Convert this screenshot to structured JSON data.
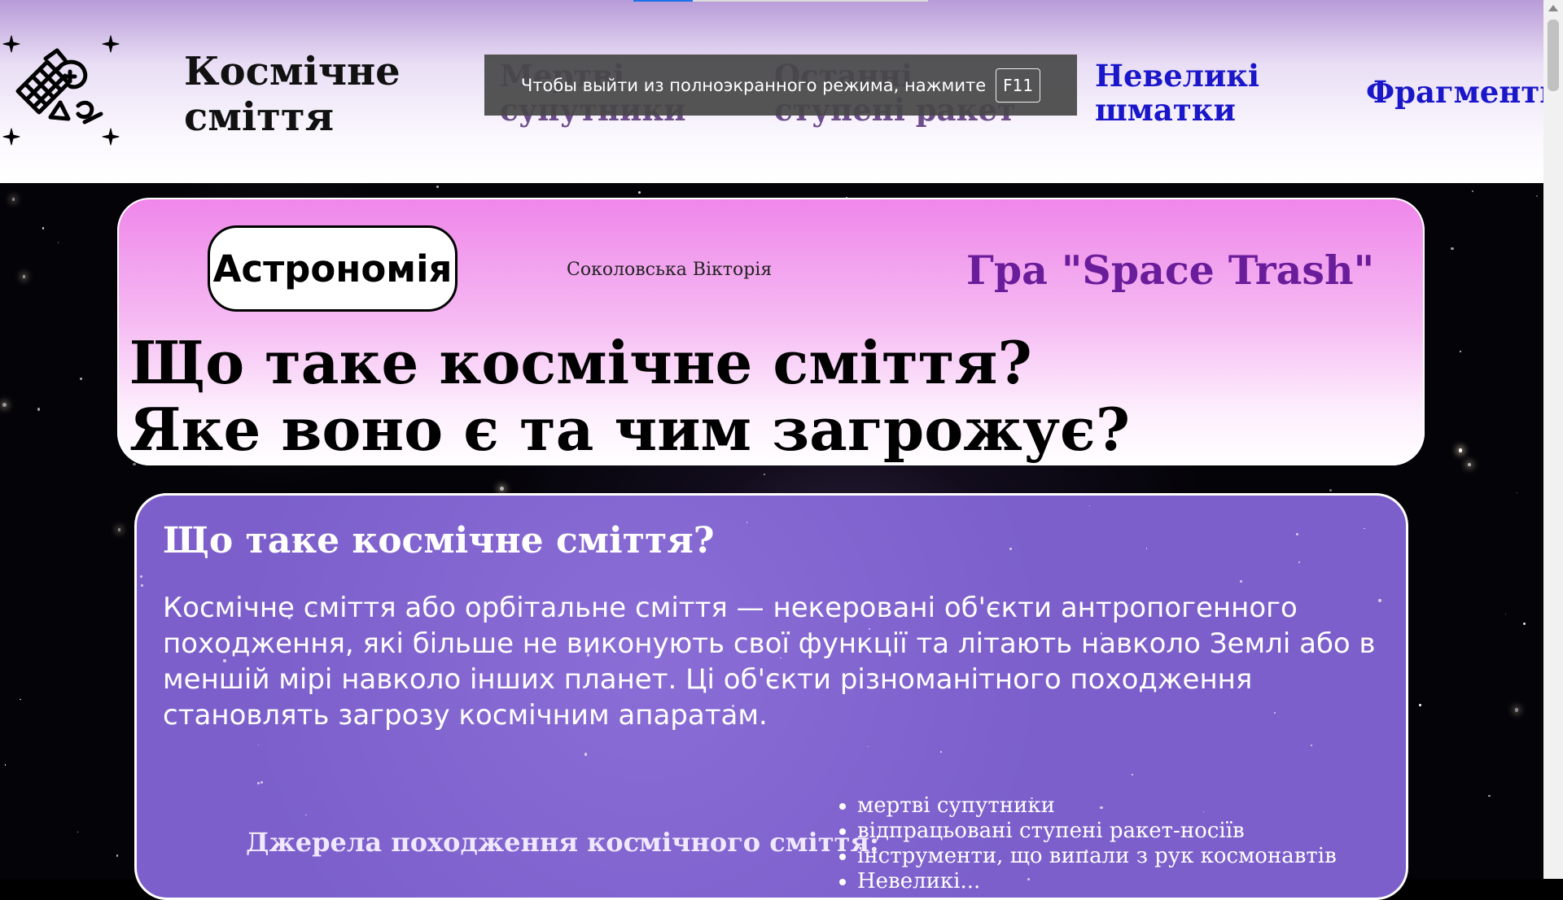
{
  "site": {
    "title": "Космічне сміття",
    "logo_icon": "space-debris-logo-icon"
  },
  "nav": {
    "items": [
      {
        "label": "Мертві супутники"
      },
      {
        "label": "Останні ступені ракет"
      },
      {
        "label": "Невеликі шматки"
      },
      {
        "label": "Фрагменти"
      }
    ]
  },
  "fullscreen_toast": {
    "message": "Чтобы выйти из полноэкранного режима, нажмите",
    "key": "F11"
  },
  "hero": {
    "button_label": "Астрономія",
    "author": "Соколовська Вікторія",
    "game_link": "Гра \"Space Trash\"",
    "title_line1": "Що таке космічне сміття?",
    "title_line2": "Яке воно є та чим загрожує?"
  },
  "content": {
    "heading": "Що таке космічне сміття?",
    "paragraph": "Космічне сміття або орбітальне сміття — некеровані об'єкти антропогенного походження, які більше не виконують свої функції та літають навколо Землі або в меншій мірі навколо інших планет. Ці об'єкти різноманітного походження становлять загрозу космічним апаратам.",
    "sources_label": "Джерела походження космічного сміття:",
    "sources": [
      "мертві супутники",
      "відпрацьовані ступені ракет-носіїв",
      "інструменти, що випали з рук космонавтів",
      "Невеликі..."
    ]
  },
  "colors": {
    "nav_link": "#1a16c9",
    "game_link": "#6a1d9a",
    "hero_top": "#ef86ea",
    "content_bg": "#7c5fcb"
  }
}
